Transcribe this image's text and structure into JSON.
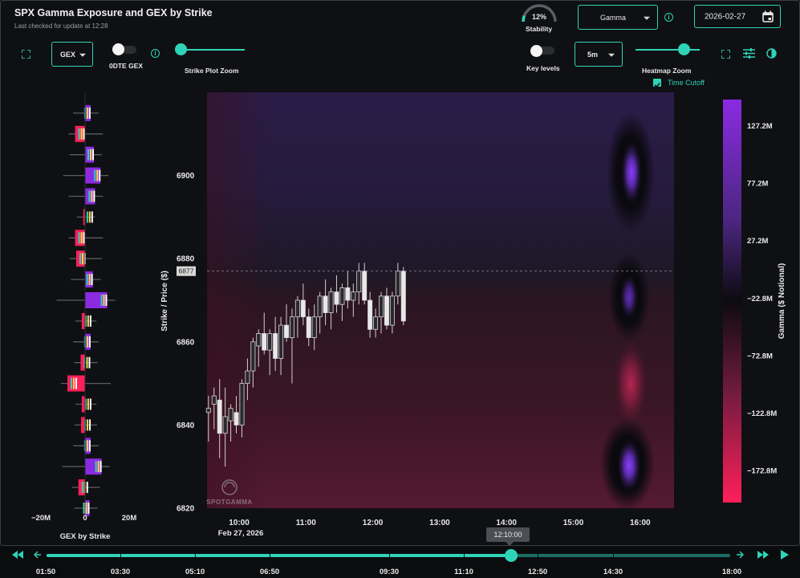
{
  "header": {
    "title": "SPX Gamma Exposure and GEX by Strike",
    "subtitle": "Last checked for update at 12:28"
  },
  "controls": {
    "stability_value": "12%",
    "stability_label": "Stability",
    "stability_fraction": 0.12,
    "greek_select": "Gamma",
    "date_value": "2026-02-27",
    "gex_select": "GEX",
    "odte_label": "0DTE GEX",
    "odte_on": false,
    "strike_zoom_label": "Strike Plot Zoom",
    "key_levels_label": "Key levels",
    "key_levels_on": false,
    "interval_select": "5m",
    "heatmap_zoom_label": "Heatmap Zoom",
    "time_cutoff_label": "Time Cutoff",
    "time_cutoff_checked": true
  },
  "icons": {
    "expand_left": "expand-icon",
    "expand_right": "expand-icon",
    "settings": "sliders-icon",
    "contrast": "contrast-icon",
    "calendar": "calendar-icon",
    "info": "info-icon"
  },
  "colors": {
    "accent": "#2fd3b8",
    "positive": "#8a2be2",
    "negative": "#ff1f5a",
    "background": "#0f1013"
  },
  "chart_data": [
    {
      "type": "bar",
      "title": "GEX by Strike",
      "orientation": "horizontal",
      "xlabel": "GEX by Strike",
      "x_ticks": [
        "−20M",
        "0",
        "20M"
      ],
      "xlim": [
        -26,
        26
      ],
      "ylim": [
        6820,
        6920
      ],
      "strike_step": 5,
      "strikes": [
        6915,
        6910,
        6905,
        6900,
        6895,
        6890,
        6885,
        6880,
        6875,
        6870,
        6865,
        6860,
        6855,
        6850,
        6845,
        6840,
        6835,
        6830,
        6825,
        6820
      ],
      "values": [
        2.5,
        -4.5,
        4,
        7,
        4.5,
        -0.8,
        -4.5,
        -4,
        3.5,
        10,
        -1.5,
        2.5,
        -2,
        -8,
        -1.5,
        -1.8,
        2.5,
        7.5,
        -3,
        2
      ]
    },
    {
      "type": "heatmap",
      "title": "",
      "ylabel": "Strike / Price ($)",
      "ylim": [
        6820,
        6920
      ],
      "y_ticks": [
        6820,
        6840,
        6860,
        6880,
        6900
      ],
      "x_ticks": [
        "10:00",
        "11:00",
        "12:00",
        "13:00",
        "14:00",
        "15:00",
        "16:00"
      ],
      "x_sub_label": "Feb 27, 2026",
      "current_price": 6877,
      "current_price_label": "6877",
      "colorbar_label": "Gamma ($ Notional)",
      "colorbar_ticks": [
        "127.2M",
        "77.2M",
        "27.2M",
        "−22.8M",
        "−72.8M",
        "−122.8M",
        "−172.8M"
      ],
      "candles": [
        {
          "o": 6843,
          "h": 6847,
          "l": 6836,
          "c": 6844
        },
        {
          "o": 6845,
          "h": 6849,
          "l": 6839,
          "c": 6847
        },
        {
          "o": 6846,
          "h": 6851,
          "l": 6832,
          "c": 6838
        },
        {
          "o": 6838,
          "h": 6849,
          "l": 6830,
          "c": 6842
        },
        {
          "o": 6841,
          "h": 6845,
          "l": 6836,
          "c": 6844
        },
        {
          "o": 6843,
          "h": 6847,
          "l": 6838,
          "c": 6840
        },
        {
          "o": 6840,
          "h": 6851,
          "l": 6837,
          "c": 6850
        },
        {
          "o": 6850,
          "h": 6856,
          "l": 6846,
          "c": 6853
        },
        {
          "o": 6853,
          "h": 6861,
          "l": 6849,
          "c": 6860
        },
        {
          "o": 6859,
          "h": 6863,
          "l": 6854,
          "c": 6862
        },
        {
          "o": 6862,
          "h": 6867,
          "l": 6857,
          "c": 6858
        },
        {
          "o": 6858,
          "h": 6863,
          "l": 6852,
          "c": 6862
        },
        {
          "o": 6862,
          "h": 6866,
          "l": 6853,
          "c": 6856
        },
        {
          "o": 6856,
          "h": 6866,
          "l": 6852,
          "c": 6864
        },
        {
          "o": 6864,
          "h": 6869,
          "l": 6860,
          "c": 6861
        },
        {
          "o": 6861,
          "h": 6868,
          "l": 6850,
          "c": 6866
        },
        {
          "o": 6866,
          "h": 6871,
          "l": 6861,
          "c": 6870
        },
        {
          "o": 6870,
          "h": 6874,
          "l": 6864,
          "c": 6866
        },
        {
          "o": 6866,
          "h": 6868,
          "l": 6859,
          "c": 6861
        },
        {
          "o": 6861,
          "h": 6869,
          "l": 6858,
          "c": 6866
        },
        {
          "o": 6866,
          "h": 6872,
          "l": 6862,
          "c": 6871
        },
        {
          "o": 6871,
          "h": 6875,
          "l": 6864,
          "c": 6867
        },
        {
          "o": 6867,
          "h": 6873,
          "l": 6863,
          "c": 6872
        },
        {
          "o": 6872,
          "h": 6876,
          "l": 6867,
          "c": 6869
        },
        {
          "o": 6869,
          "h": 6874,
          "l": 6865,
          "c": 6873
        },
        {
          "o": 6873,
          "h": 6877,
          "l": 6868,
          "c": 6870
        },
        {
          "o": 6870,
          "h": 6874,
          "l": 6866,
          "c": 6872
        },
        {
          "o": 6872,
          "h": 6879,
          "l": 6869,
          "c": 6877
        },
        {
          "o": 6877,
          "h": 6879,
          "l": 6869,
          "c": 6870
        },
        {
          "o": 6870,
          "h": 6872,
          "l": 6861,
          "c": 6863
        },
        {
          "o": 6863,
          "h": 6868,
          "l": 6861,
          "c": 6866
        },
        {
          "o": 6866,
          "h": 6872,
          "l": 6862,
          "c": 6871
        },
        {
          "o": 6871,
          "h": 6873,
          "l": 6863,
          "c": 6864
        },
        {
          "o": 6864,
          "h": 6872,
          "l": 6862,
          "c": 6871
        },
        {
          "o": 6871,
          "h": 6879,
          "l": 6869,
          "c": 6877
        },
        {
          "o": 6877,
          "h": 6878,
          "l": 6864,
          "c": 6865
        }
      ],
      "watermark": "SPOTGAMMA"
    }
  ],
  "timeline": {
    "current_time_label": "12:10:00",
    "progress_fraction": 0.68,
    "ticks": [
      "01:50",
      "03:30",
      "05:10",
      "06:50",
      "09:30",
      "11:10",
      "12:50",
      "14:30",
      "18:00"
    ]
  }
}
